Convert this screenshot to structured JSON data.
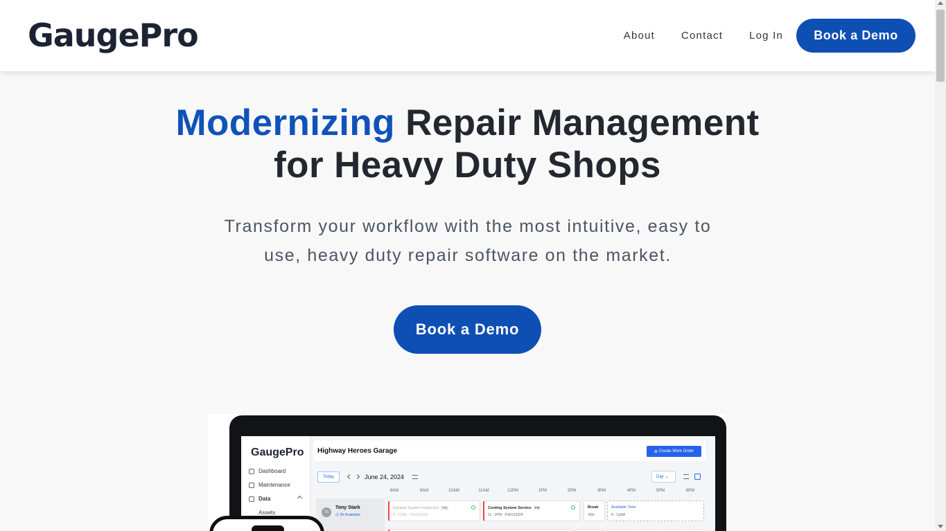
{
  "header": {
    "logo": "GaugePro",
    "nav": [
      "About",
      "Contact",
      "Log In"
    ],
    "cta": "Book a Demo"
  },
  "hero": {
    "title_accent": "Modernizing",
    "title_rest_line1": "Repair Management",
    "title_line2": "for Heavy Duty Shops",
    "subtitle_line1": "Transform your workflow with the most intuitive, easy to",
    "subtitle_line2": "use, heavy duty repair software on the market.",
    "cta": "Book a Demo"
  },
  "app_preview": {
    "logo": "GaugePro",
    "sidebar": [
      "Dashboard",
      "Maintenance",
      "Data",
      "Assets"
    ],
    "garage": "Highway Heroes Garage",
    "create_button": "Create Work Order",
    "today": "Today",
    "date": "June 24, 2024",
    "view": "Day",
    "hours": [
      "8AM",
      "9AM",
      "10AM",
      "11AM",
      "12PM",
      "1PM",
      "2PM",
      "3PM",
      "4PM",
      "5PM",
      "6PM"
    ],
    "tech": {
      "initials": "TS",
      "name": "Tony Stark",
      "availability": "3h Available"
    },
    "cards": [
      {
        "title": "Exhaust System Inspection",
        "tag": "PM",
        "sub": "8 - 11AM · PS0123003"
      },
      {
        "title": "Cooling System Service",
        "tag": "PM",
        "sub": "11 - 2PM · PS0123324"
      },
      {
        "title": "Break",
        "sub": "30m"
      },
      {
        "title": "Available Time",
        "sub": "8 - 11AM"
      }
    ]
  },
  "colors": {
    "accent": "#1052b8",
    "button": "#0e4fb4",
    "text_dark": "#23272f",
    "text_muted": "#4b5563"
  }
}
